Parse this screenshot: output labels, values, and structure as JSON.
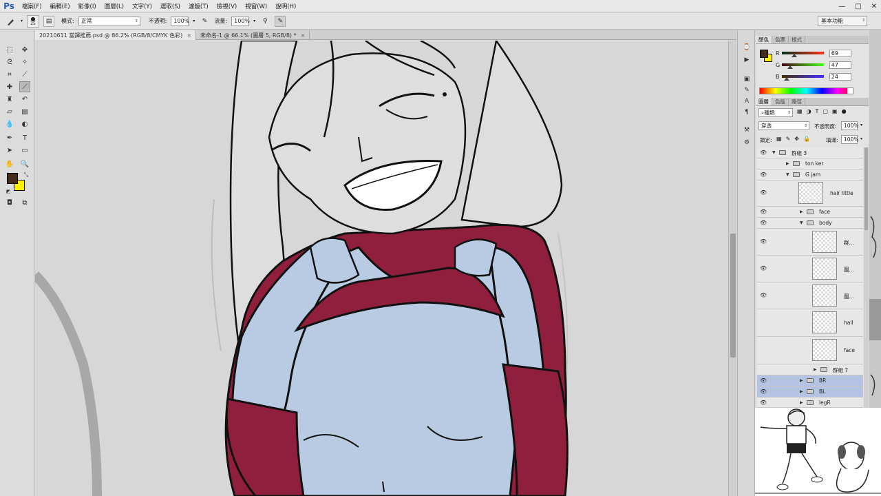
{
  "app": {
    "logo": "Ps",
    "menu": [
      "檔案(F)",
      "編輯(E)",
      "影像(I)",
      "圖層(L)",
      "文字(Y)",
      "選取(S)",
      "濾鏡(T)",
      "檢視(V)",
      "視窗(W)",
      "說明(H)"
    ],
    "window_controls": {
      "minimize": "—",
      "maximize": "□",
      "close": "✕"
    }
  },
  "options_bar": {
    "brush_size": "25",
    "mode_label": "模式:",
    "mode_value": "正常",
    "opacity_label": "不透明:",
    "opacity_value": "100%",
    "flow_label": "流量:",
    "flow_value": "100%",
    "workspace": "基本功能"
  },
  "document_tabs": [
    {
      "title": "20210611 當譯推薦.psd @ 86.2% (RGB/8/CMYK 色彩)",
      "close": "×",
      "active": true
    },
    {
      "title": "未命名-1 @ 66.1% (圖層 5, RGB/8) *",
      "close": "×",
      "active": false
    }
  ],
  "tools": {
    "foreground_color": "#452b1c",
    "background_color": "#fff200"
  },
  "color_panel": {
    "tabs": [
      "顏色",
      "色票",
      "樣式"
    ],
    "channels": [
      {
        "name": "R",
        "value": "69",
        "fraction": 0.27
      },
      {
        "name": "G",
        "value": "47",
        "fraction": 0.18
      },
      {
        "name": "B",
        "value": "24",
        "fraction": 0.09
      }
    ]
  },
  "layers_panel": {
    "tabs": [
      "圖層",
      "色版",
      "路徑"
    ],
    "filter_kind": "種類",
    "blend_mode": "穿透",
    "opacity_label": "不透明度:",
    "opacity_value": "100%",
    "lock_label": "鎖定:",
    "fill_label": "填滿:",
    "fill_value": "100%",
    "layers": [
      {
        "name": "群組 3",
        "kind": "group",
        "visible": true,
        "expanded": true,
        "selected": false
      },
      {
        "name": "ton ker",
        "kind": "group",
        "visible": false,
        "expanded": false,
        "selected": false
      },
      {
        "name": "G jam",
        "kind": "group",
        "visible": true,
        "expanded": true,
        "selected": false
      },
      {
        "name": "hair little",
        "kind": "layer",
        "visible": true,
        "selected": false
      },
      {
        "name": "face",
        "kind": "group",
        "visible": true,
        "expanded": false,
        "selected": false
      },
      {
        "name": "body",
        "kind": "group",
        "visible": true,
        "expanded": true,
        "selected": false
      },
      {
        "name": "群...",
        "kind": "layer",
        "visible": true,
        "selected": false
      },
      {
        "name": "圖...",
        "kind": "layer",
        "visible": true,
        "selected": false
      },
      {
        "name": "圖...",
        "kind": "layer",
        "visible": true,
        "selected": false
      },
      {
        "name": "hall",
        "kind": "layer",
        "visible": false,
        "selected": false
      },
      {
        "name": "face",
        "kind": "layer",
        "visible": false,
        "selected": false
      },
      {
        "name": "群組 7",
        "kind": "group",
        "visible": false,
        "expanded": false,
        "selected": false
      },
      {
        "name": "BR",
        "kind": "group",
        "visible": true,
        "expanded": false,
        "selected": true
      },
      {
        "name": "BL",
        "kind": "group",
        "visible": true,
        "expanded": false,
        "selected": true
      },
      {
        "name": "legR",
        "kind": "group",
        "visible": true,
        "expanded": false,
        "selected": false
      }
    ]
  },
  "artwork_colors": {
    "skin": "#b8cbe2",
    "sweater": "#8f1f3d",
    "hair": "#dcdcdc",
    "line": "#111111"
  }
}
